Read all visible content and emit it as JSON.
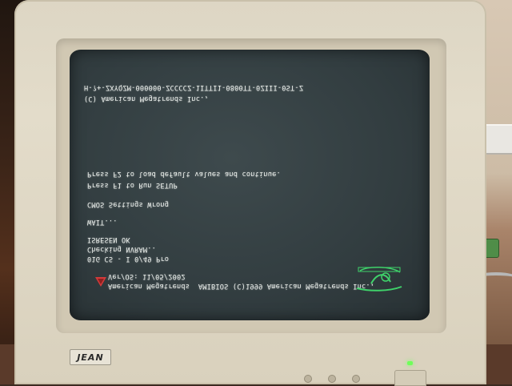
{
  "scene": "photo",
  "monitor": {
    "brand": "JEAN",
    "power_led_color": "#6fff5a"
  },
  "bios_screen": {
    "lines": [
      "H-?+-ZXYQZM-000000-ZCCCCZ-1ITTI1-0800TT-0ZIII-0ST-Z",
      "(C) American Megatrends Inc.,",
      "Press F2 to load default values and continue.",
      "Press F1 to Run SETUP",
      "CMOS Settings Wrong",
      "WAIT...",
      "ISRESEN OK",
      "Checking NVRAM..",
      "01G CS - I 0/49 Pro",
      "Ver/OS: 11/05/2002",
      "American Megatrends  AMIBIOS (C)1999 American Megatrends Inc.,"
    ],
    "logo_color": "#d23a3a",
    "energy_star_color": "#3fd26a"
  }
}
